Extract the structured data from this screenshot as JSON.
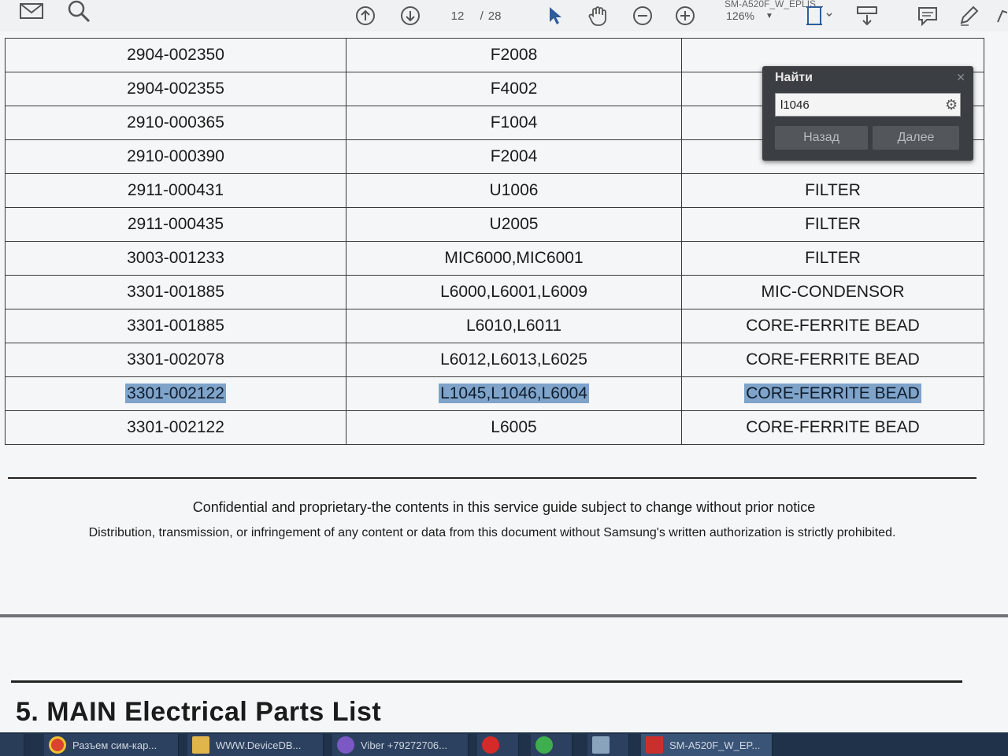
{
  "toolbar": {
    "title_tab": "SM-A520F_W_EPLIS...",
    "page_current": "12",
    "page_separator": "/",
    "page_total": "28",
    "zoom": "126%"
  },
  "find": {
    "title": "Найти",
    "query": "l1046",
    "back_label": "Назад",
    "next_label": "Далее"
  },
  "table": {
    "rows": [
      {
        "code": "2904-002350",
        "location": "F2008",
        "desc": ""
      },
      {
        "code": "2904-002355",
        "location": "F4002",
        "desc": ""
      },
      {
        "code": "2910-000365",
        "location": "F1004",
        "desc": ""
      },
      {
        "code": "2910-000390",
        "location": "F2004",
        "desc": ""
      },
      {
        "code": "2911-000431",
        "location": "U1006",
        "desc": "FILTER"
      },
      {
        "code": "2911-000435",
        "location": "U2005",
        "desc": "FILTER"
      },
      {
        "code": "3003-001233",
        "location": "MIC6000,MIC6001",
        "desc": "FILTER"
      },
      {
        "code": "3301-001885",
        "location": "L6000,L6001,L6009",
        "desc": "MIC-CONDENSOR"
      },
      {
        "code": "3301-001885",
        "location": "L6010,L6011",
        "desc": "CORE-FERRITE BEAD"
      },
      {
        "code": "3301-002078",
        "location": "L6012,L6013,L6025",
        "desc": "CORE-FERRITE BEAD"
      },
      {
        "code": "3301-002122",
        "location": "L1045,L1046,L6004",
        "desc": "CORE-FERRITE BEAD",
        "highlighted": true
      },
      {
        "code": "3301-002122",
        "location": "L6005",
        "desc": "CORE-FERRITE BEAD"
      }
    ]
  },
  "footer": {
    "line1": "Confidential and proprietary-the contents in this service guide subject to change without prior notice",
    "line2": "Distribution, transmission, or infringement of any content or data from this document without Samsung's written authorization is strictly prohibited."
  },
  "section": {
    "title": "5. MAIN Electrical Parts List"
  },
  "taskbar": {
    "items": [
      {
        "label": "Разъем сим-кар...",
        "icon": "chrome-icon"
      },
      {
        "label": "WWW.DeviceDB...",
        "icon": "folder-icon"
      },
      {
        "label": "Viber +79272706...",
        "icon": "viber-icon"
      },
      {
        "label": "",
        "icon": "opera-icon"
      },
      {
        "label": "",
        "icon": "whatsapp-icon"
      },
      {
        "label": "",
        "icon": "app-icon"
      },
      {
        "label": "SM-A520F_W_EP...",
        "icon": "pdf-icon"
      }
    ]
  }
}
